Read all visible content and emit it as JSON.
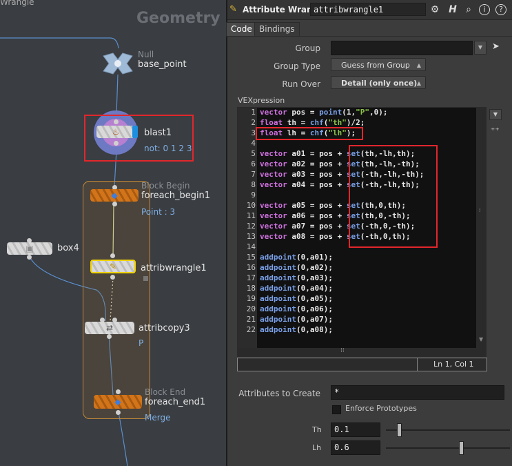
{
  "network": {
    "top_title": "Wrangle",
    "context_label": "Geometry",
    "nodes": {
      "base_point": {
        "type": "Null",
        "name": "base_point"
      },
      "blast1": {
        "name": "blast1",
        "sub": "not: 0 1 2 3"
      },
      "foreach_begin1": {
        "type": "Block Begin",
        "name": "foreach_begin1",
        "sub": "Point : 3"
      },
      "box4": {
        "name": "box4"
      },
      "attribwrangle1": {
        "name": "attribwrangle1"
      },
      "attribcopy3": {
        "name": "attribcopy3",
        "sub": "P"
      },
      "foreach_end1": {
        "type": "Block End",
        "name": "foreach_end1",
        "sub": "Merge"
      }
    }
  },
  "panel": {
    "title": "Attribute Wrangle",
    "node_name": "attribwrangle1",
    "icons": {
      "gear": "gear-icon",
      "help": "H",
      "search": "search-icon",
      "info": "i",
      "question": "?"
    },
    "tabs": [
      "Code",
      "Bindings"
    ],
    "params": {
      "group_label": "Group",
      "group_value": "",
      "group_type_label": "Group Type",
      "group_type_value": "Guess from Group",
      "run_over_label": "Run Over",
      "run_over_value": "Detail (only once)",
      "vexpression_label": "VEXpression"
    },
    "status": "Ln 1, Col 1",
    "attributes_to_create_label": "Attributes to Create",
    "attributes_to_create_value": "*",
    "enforce_prototypes_label": "Enforce Prototypes",
    "th_label": "Th",
    "th_value": "0.1",
    "th_slider": 0.1,
    "lh_label": "Lh",
    "lh_value": "0.6",
    "lh_slider": 0.6
  },
  "code_lines": [
    {
      "n": "1",
      "t": "vector pos = point(1,\"P\",0);"
    },
    {
      "n": "2",
      "t": "float th = chf(\"th\")/2;"
    },
    {
      "n": "3",
      "t": "float lh = chf(\"lh\");"
    },
    {
      "n": "4",
      "t": ""
    },
    {
      "n": "5",
      "t": "vector a01 = pos + set(th,-lh,th);"
    },
    {
      "n": "6",
      "t": "vector a02 = pos + set(th,-lh,-th);"
    },
    {
      "n": "7",
      "t": "vector a03 = pos + set(-th,-lh,-th);"
    },
    {
      "n": "8",
      "t": "vector a04 = pos + set(-th,-lh,th);"
    },
    {
      "n": "9",
      "t": ""
    },
    {
      "n": "10",
      "t": "vector a05 = pos + set(th,0,th);"
    },
    {
      "n": "11",
      "t": "vector a06 = pos + set(th,0,-th);"
    },
    {
      "n": "12",
      "t": "vector a07 = pos + set(-th,0,-th);"
    },
    {
      "n": "13",
      "t": "vector a08 = pos + set(-th,0,th);"
    },
    {
      "n": "14",
      "t": ""
    },
    {
      "n": "15",
      "t": "addpoint(0,a01);"
    },
    {
      "n": "16",
      "t": "addpoint(0,a02);"
    },
    {
      "n": "17",
      "t": "addpoint(0,a03);"
    },
    {
      "n": "18",
      "t": "addpoint(0,a04);"
    },
    {
      "n": "19",
      "t": "addpoint(0,a05);"
    },
    {
      "n": "20",
      "t": "addpoint(0,a06);"
    },
    {
      "n": "21",
      "t": "addpoint(0,a07);"
    },
    {
      "n": "22",
      "t": "addpoint(0,a08);"
    }
  ]
}
